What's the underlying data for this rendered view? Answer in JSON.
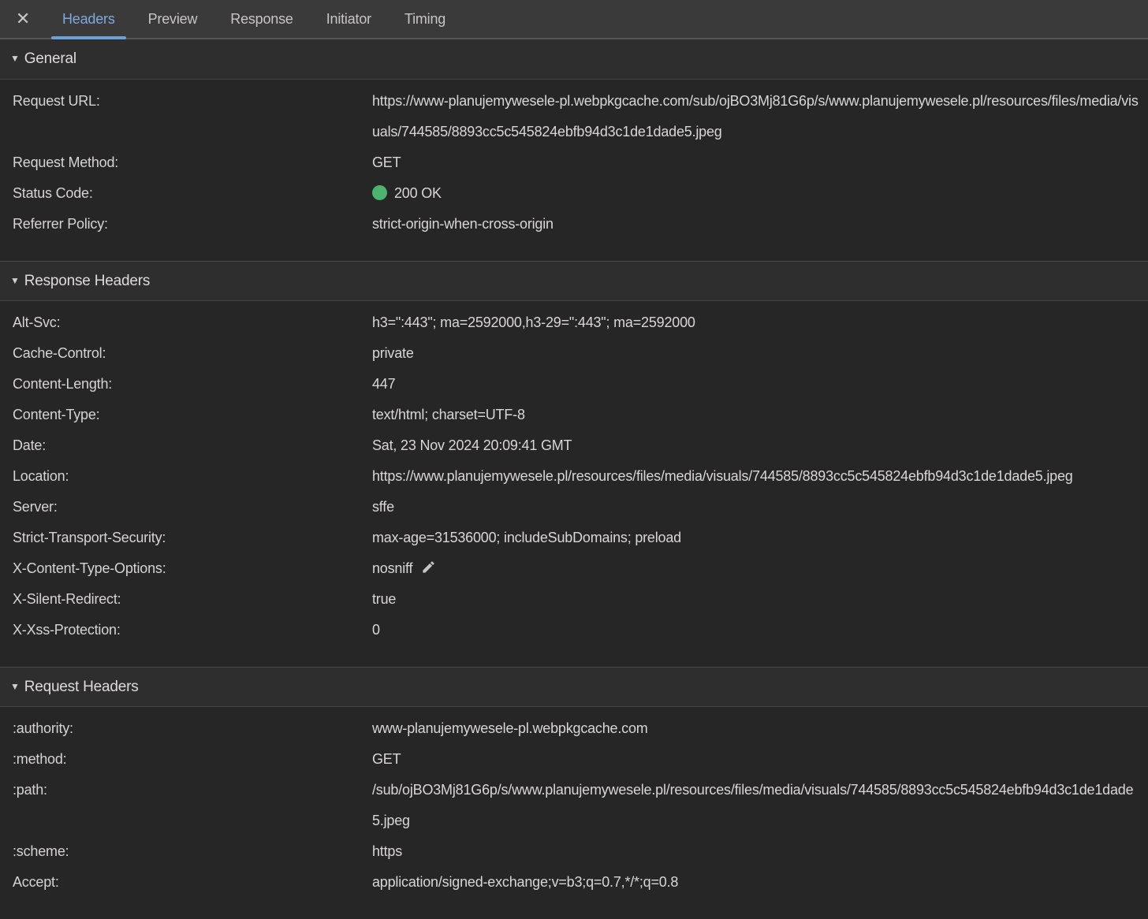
{
  "colors": {
    "accent_blue": "#7fa9dd",
    "status_green": "#4db370",
    "tabbar_bg": "#3a3a3a",
    "panel_bg": "#262626",
    "section_header_bg": "#2e2e2e"
  },
  "tabbar": {
    "close_icon": "✕",
    "tabs": [
      {
        "label": "Headers",
        "active": true
      },
      {
        "label": "Preview",
        "active": false
      },
      {
        "label": "Response",
        "active": false
      },
      {
        "label": "Initiator",
        "active": false
      },
      {
        "label": "Timing",
        "active": false
      }
    ]
  },
  "sections": [
    {
      "title": "General",
      "collapse_icon": "▼",
      "rows": [
        {
          "name": "Request URL:",
          "value": "https://www-planujemywesele-pl.webpkgcache.com/sub/ojBO3Mj81G6p/s/www.planujemywesele.pl/resources/files/media/visuals/744585/8893cc5c545824ebfb94d3c1de1dade5.jpeg"
        },
        {
          "name": "Request Method:",
          "value": "GET"
        },
        {
          "name": "Status Code:",
          "value": "200 OK",
          "status_dot": true
        },
        {
          "name": "Referrer Policy:",
          "value": "strict-origin-when-cross-origin"
        }
      ]
    },
    {
      "title": "Response Headers",
      "collapse_icon": "▼",
      "rows": [
        {
          "name": "Alt-Svc:",
          "value": "h3=\":443\"; ma=2592000,h3-29=\":443\"; ma=2592000"
        },
        {
          "name": "Cache-Control:",
          "value": "private"
        },
        {
          "name": "Content-Length:",
          "value": "447"
        },
        {
          "name": "Content-Type:",
          "value": "text/html; charset=UTF-8"
        },
        {
          "name": "Date:",
          "value": "Sat, 23 Nov 2024 20:09:41 GMT"
        },
        {
          "name": "Location:",
          "value": "https://www.planujemywesele.pl/resources/files/media/visuals/744585/8893cc5c545824ebfb94d3c1de1dade5.jpeg"
        },
        {
          "name": "Server:",
          "value": "sffe"
        },
        {
          "name": "Strict-Transport-Security:",
          "value": "max-age=31536000; includeSubDomains; preload"
        },
        {
          "name": "X-Content-Type-Options:",
          "value": "nosniff",
          "edit_icon": true
        },
        {
          "name": "X-Silent-Redirect:",
          "value": "true"
        },
        {
          "name": "X-Xss-Protection:",
          "value": "0"
        }
      ]
    },
    {
      "title": "Request Headers",
      "collapse_icon": "▼",
      "rows": [
        {
          "name": ":authority:",
          "value": "www-planujemywesele-pl.webpkgcache.com"
        },
        {
          "name": ":method:",
          "value": "GET"
        },
        {
          "name": ":path:",
          "value": "/sub/ojBO3Mj81G6p/s/www.planujemywesele.pl/resources/files/media/visuals/744585/8893cc5c545824ebfb94d3c1de1dade5.jpeg"
        },
        {
          "name": ":scheme:",
          "value": "https"
        },
        {
          "name": "Accept:",
          "value": "application/signed-exchange;v=b3;q=0.7,*/*;q=0.8"
        }
      ]
    }
  ]
}
